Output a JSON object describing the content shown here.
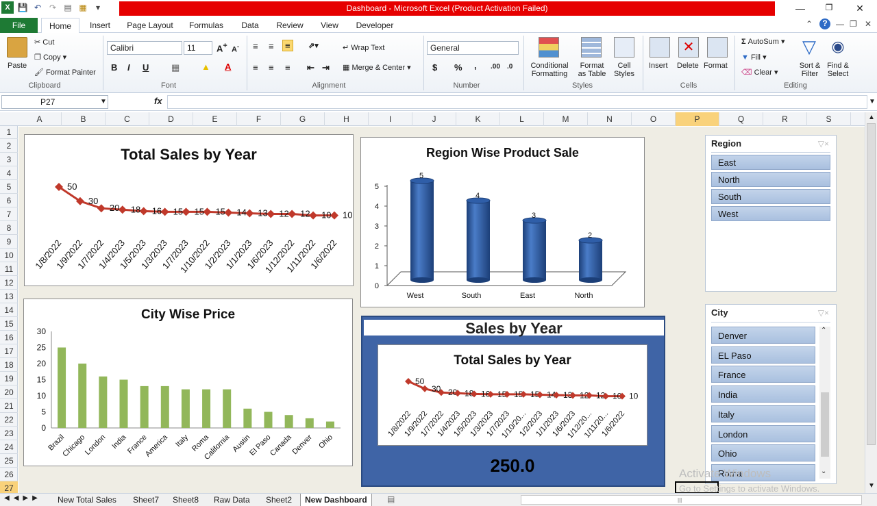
{
  "window": {
    "title": "Dashboard  -  Microsoft Excel (Product Activation Failed)"
  },
  "ribbon_tabs": [
    "File",
    "Home",
    "Insert",
    "Page Layout",
    "Formulas",
    "Data",
    "Review",
    "View",
    "Developer"
  ],
  "ribbon": {
    "clipboard": {
      "paste": "Paste",
      "cut": "Cut",
      "copy": "Copy",
      "format_painter": "Format Painter",
      "label": "Clipboard"
    },
    "font": {
      "name": "Calibri",
      "size": "11",
      "label": "Font",
      "bold": "B",
      "italic": "I",
      "underline": "U"
    },
    "alignment": {
      "wrap_text": "Wrap Text",
      "merge_center": "Merge & Center",
      "label": "Alignment"
    },
    "number": {
      "format": "General",
      "label": "Number",
      "currency": "$",
      "percent": "%",
      "comma": ","
    },
    "styles": {
      "conditional": "Conditional",
      "conditional2": "Formatting",
      "format_as": "Format",
      "format_as2": "as Table",
      "cell": "Cell",
      "cell2": "Styles",
      "label": "Styles"
    },
    "cells": {
      "insert": "Insert",
      "delete": "Delete",
      "format": "Format",
      "label": "Cells"
    },
    "editing": {
      "autosum": "AutoSum",
      "fill": "Fill",
      "clear": "Clear",
      "sort": "Sort &",
      "sort2": "Filter",
      "find": "Find &",
      "find2": "Select",
      "label": "Editing"
    }
  },
  "formula_bar": {
    "name_box": "P27",
    "fx": "fx",
    "value": ""
  },
  "columns": [
    "A",
    "B",
    "C",
    "D",
    "E",
    "F",
    "G",
    "H",
    "I",
    "J",
    "K",
    "L",
    "M",
    "N",
    "O",
    "P",
    "Q",
    "R",
    "S"
  ],
  "selected_column": "P",
  "rows": [
    "1",
    "2",
    "3",
    "4",
    "5",
    "6",
    "7",
    "8",
    "9",
    "10",
    "11",
    "12",
    "13",
    "14",
    "15",
    "16",
    "17",
    "18",
    "19",
    "20",
    "21",
    "22",
    "23",
    "24",
    "25",
    "26",
    "27"
  ],
  "selected_row": "27",
  "chart_data": [
    {
      "type": "line",
      "title": "Total Sales by Year",
      "categories": [
        "1/8/2022",
        "1/9/2022",
        "1/7/2022",
        "1/4/2023",
        "1/5/2023",
        "1/3/2023",
        "1/7/2023",
        "1/10/2022",
        "1/2/2023",
        "1/1/2023",
        "1/6/2023",
        "1/12/2022",
        "1/11/2022",
        "1/6/2022"
      ],
      "values": [
        50,
        30,
        20,
        18,
        16,
        15,
        15,
        15,
        14,
        13,
        12,
        12,
        10,
        10
      ],
      "color": "#c0392b"
    },
    {
      "type": "bar",
      "title": "Region Wise Product Sale",
      "categories": [
        "West",
        "South",
        "East",
        "North"
      ],
      "values": [
        5,
        4,
        3,
        2
      ],
      "ylim": [
        0,
        5
      ],
      "yticks": [
        "0",
        "1",
        "2",
        "3",
        "4",
        "5"
      ],
      "color": "#2e5fa8"
    },
    {
      "type": "bar",
      "title": "City Wise Price",
      "categories": [
        "Brazil",
        "Chicago",
        "London",
        "India",
        "France",
        "America",
        "Italy",
        "Roma",
        "California",
        "Austin",
        "El Paso",
        "Canada",
        "Denver",
        "Ohio"
      ],
      "values": [
        25,
        20,
        16,
        15,
        13,
        13,
        12,
        12,
        12,
        6,
        5,
        4,
        3,
        2
      ],
      "ylim": [
        0,
        30
      ],
      "yticks": [
        "0",
        "5",
        "10",
        "15",
        "20",
        "25",
        "30"
      ],
      "color": "#92b75a"
    },
    {
      "type": "line",
      "title": "Total Sales by Year",
      "categories": [
        "1/8/2022",
        "1/9/2022",
        "1/7/2022",
        "1/4/2023",
        "1/5/2023",
        "1/3/2023",
        "1/7/2023",
        "1/10/20...",
        "1/2/2023",
        "1/1/2023",
        "1/6/2023",
        "1/12/20...",
        "1/11/20...",
        "1/6/2022"
      ],
      "values": [
        50,
        30,
        20,
        18,
        16,
        15,
        15,
        15,
        14,
        13,
        12,
        12,
        10,
        10
      ],
      "color": "#c0392b"
    }
  ],
  "kpi_card": {
    "title": "Sales by Year",
    "value": "250.0"
  },
  "slicers": {
    "region": {
      "header": "Region",
      "items": [
        "East",
        "North",
        "South",
        "West"
      ]
    },
    "city": {
      "header": "City",
      "items": [
        "Denver",
        "EL Paso",
        "France",
        "India",
        "Italy",
        "London",
        "Ohio",
        "Roma"
      ]
    }
  },
  "sheet_tabs": [
    "New Total Sales",
    "Sheet7",
    "Sheet8",
    "Raw Data",
    "Sheet2",
    "New Dashboard"
  ],
  "active_sheet": "New Dashboard",
  "watermark": {
    "line1": "Activate Windows",
    "line2": "Go to Settings to activate Windows."
  }
}
